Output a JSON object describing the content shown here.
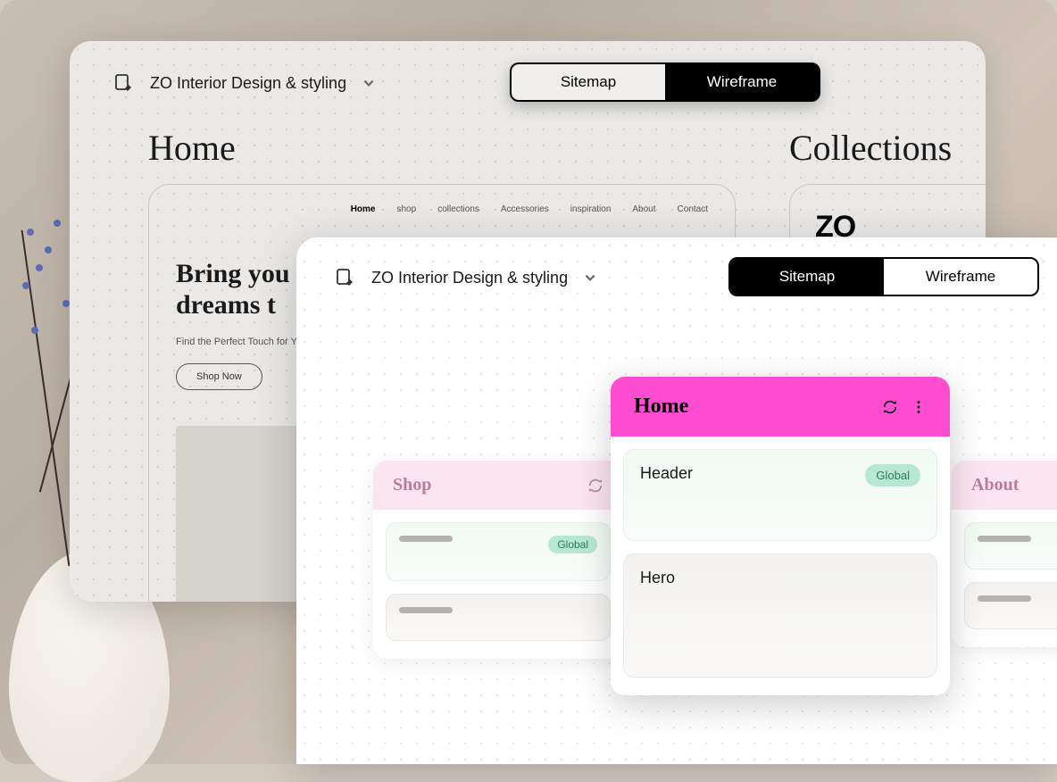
{
  "project_name": "ZO Interior Design & styling",
  "toggle": {
    "sitemap": "Sitemap",
    "wireframe": "Wireframe"
  },
  "back_panel": {
    "pages": {
      "home": "Home",
      "collections": "Collections"
    },
    "preview": {
      "nav": [
        "Home",
        "shop",
        "collections",
        "Accessories",
        "inspiration",
        "About",
        "Contact"
      ],
      "hero_line1": "Bring you",
      "hero_line2": "dreams t",
      "subtitle": "Find the Perfect Touch for Yo",
      "cta": "Shop Now"
    },
    "logo": "ZO"
  },
  "front_panel": {
    "cards": {
      "shop": {
        "title": "Shop",
        "badge": "Global"
      },
      "home": {
        "title": "Home",
        "sections": [
          {
            "label": "Header",
            "badge": "Global"
          },
          {
            "label": "Hero"
          }
        ]
      },
      "about": {
        "title": "About"
      }
    }
  }
}
